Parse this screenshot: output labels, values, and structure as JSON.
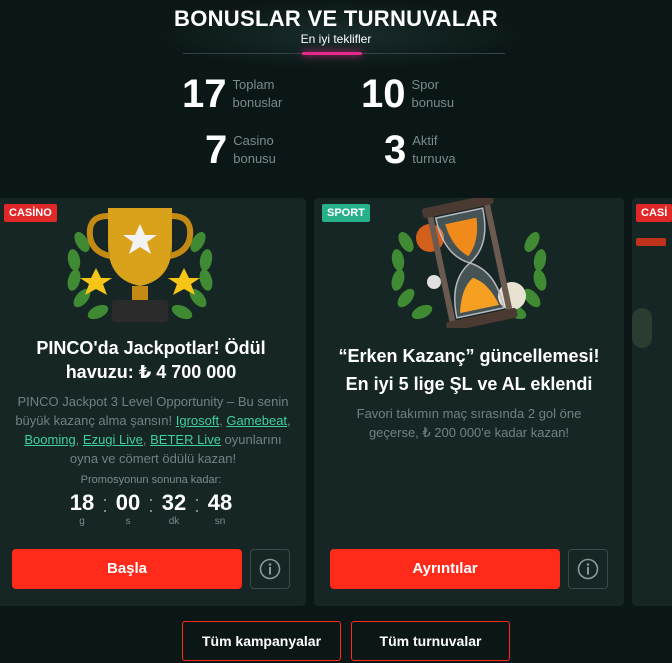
{
  "header": {
    "title": "BONUSLAR VE TURNUVALAR",
    "subtitle": "En iyi teklifler"
  },
  "stats": [
    {
      "value": "17",
      "label": "Toplam\nbonuslar"
    },
    {
      "value": "10",
      "label": "Spor\nbonusu"
    },
    {
      "value": "7",
      "label": "Casino\nbonusu"
    },
    {
      "value": "3",
      "label": "Aktif\nturnuva"
    }
  ],
  "cards": [
    {
      "badge": "CASİNO",
      "title_line1": "PINCO'da Jackpotlar! Ödül",
      "title_line2": "havuzu: ₺ 4 700 000",
      "desc_text1": "PINCO Jackpot 3 Level Opportunity – Bu senin büyük kazanç alma şansın! ",
      "links": [
        "Igrosoft",
        "Gamebeat",
        "Booming",
        "Ezugi Live",
        "BETER Live"
      ],
      "desc_text2": " oyunlarını oyna ve cömert ödülü kazan!",
      "promo_label": "Promosyonun sonuna kadar:",
      "timer": [
        {
          "value": "18",
          "unit": "g"
        },
        {
          "value": "00",
          "unit": "s"
        },
        {
          "value": "32",
          "unit": "dk"
        },
        {
          "value": "48",
          "unit": "sn"
        }
      ],
      "button": "Başla"
    },
    {
      "badge": "SPORT",
      "title_line1": "“Erken Kazanç” güncellemesi!",
      "title_line2": "En iyi 5 lige ŞL ve AL eklendi",
      "desc": "Favori takımın maç sırasında 2 gol öne geçerse, ₺ 200 000'e kadar kazan!",
      "button": "Ayrıntılar"
    },
    {
      "badge": "CASİ"
    }
  ],
  "footer": {
    "all_campaigns": "Tüm kampanyalar",
    "all_tournaments": "Tüm turnuvalar"
  },
  "colors": {
    "background": "#0b1716",
    "card": "#152624",
    "accent_red": "#ff2a1a",
    "accent_pink": "#e7298a",
    "casino_badge": "#e02828",
    "sport_badge": "#26b18b",
    "link": "#3fd0a0"
  },
  "icons": [
    "trophy-icon",
    "hourglass-icon",
    "info-icon"
  ]
}
